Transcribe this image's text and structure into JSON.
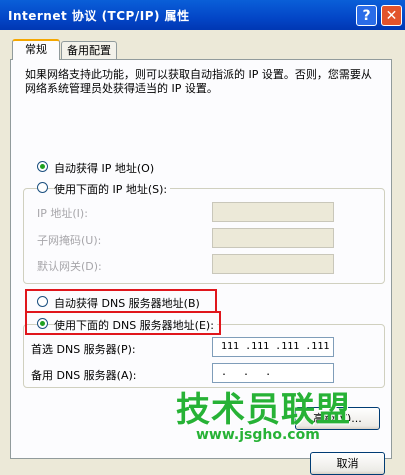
{
  "window": {
    "title": "Internet 协议 (TCP/IP) 属性",
    "help_glyph": "?",
    "close_glyph": "✕"
  },
  "tabs": [
    {
      "label": "常规"
    },
    {
      "label": "备用配置"
    }
  ],
  "description": "如果网络支持此功能，则可以获取自动指派的 IP 设置。否则，您需要从网络系统管理员处获得适当的 IP 设置。",
  "ip": {
    "auto_label": "自动获得 IP 地址(O)",
    "manual_label": "使用下面的 IP 地址(S):",
    "fields": [
      {
        "label": "IP 地址(I):",
        "value": ""
      },
      {
        "label": "子网掩码(U):",
        "value": ""
      },
      {
        "label": "默认网关(D):",
        "value": ""
      }
    ]
  },
  "dns": {
    "auto_label": "自动获得 DNS 服务器地址(B)",
    "manual_label": "使用下面的 DNS 服务器地址(E):",
    "preferred_label": "首选 DNS 服务器(P):",
    "preferred_value": "111 .111 .111 .111",
    "alternate_label": "备用 DNS 服务器(A):",
    "alternate_value": " .  .  . "
  },
  "buttons": {
    "advanced": "高级(V)...",
    "cancel": "取消"
  },
  "watermark": {
    "chinese": "技术员联盟",
    "url": "www.jsgho.com"
  },
  "colors": {
    "highlight": "#e0161c",
    "watermark": "#27b236",
    "titlebar": "#0346c7"
  }
}
